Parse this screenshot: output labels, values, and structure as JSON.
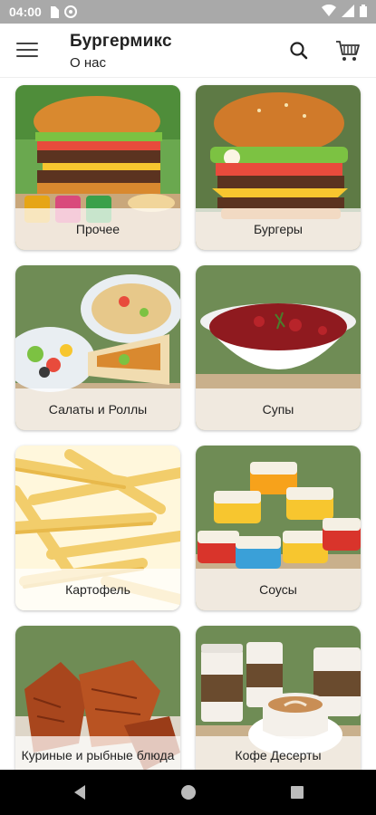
{
  "statusbar": {
    "time": "04:00"
  },
  "appbar": {
    "title": "Бургермикс",
    "subtitle": "О нас"
  },
  "categories": [
    {
      "label": "Прочее"
    },
    {
      "label": "Бургеры"
    },
    {
      "label": "Салаты и Роллы"
    },
    {
      "label": "Супы"
    },
    {
      "label": "Картофель"
    },
    {
      "label": "Соусы"
    },
    {
      "label": "Куриные и рыбные блюда"
    },
    {
      "label": "Кофе Десерты"
    }
  ],
  "colors": {
    "statusbar": "#a9a9a9",
    "accent_bg": "#ffffff",
    "text": "#222222"
  }
}
